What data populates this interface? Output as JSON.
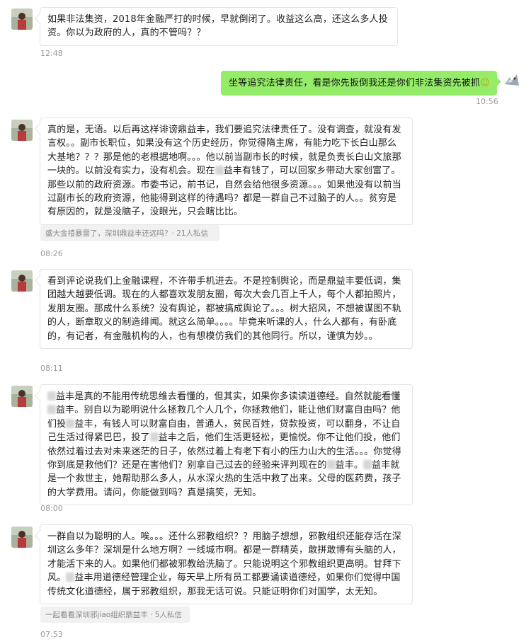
{
  "messages": [
    {
      "text": "如果非法集资，2018年金融严打的时候，早就倒闭了。收益这么高，还这么多人投资。你以为政府的人，真的不管吗？？",
      "time": "12:48"
    },
    {
      "text": "坐等追究法律责任，看是你先扳倒我还是你们非法集资先被抓",
      "emoji": "☺",
      "time": "10:56"
    },
    {
      "text_a": "真的是，无语。以后再这样诽谤鼎益丰，我们要追究法律责任了。没有调查，就没有发言权。。副市长职位，如果没有这个历史经历，你觉得隋主席，有能力吃下长白山那么大基地？？？那是他的老根据地啊。。。他以前当副市长的时候，就是负责长白山文旅那一块的。以前没有实力，没有机会。现在",
      "text_b": "益丰有钱了，可以回家乡带动大家创富了。那些以前的政府资源。市委书记，前书记，自然会给他很多资源。。。如果他没有以前当过副市长的政府资源，他能得到这样的待遇吗？都是一群自己不过脑子的人。。贫穷是有原因的，就是没脑子，没眼光，只会瞎比比。",
      "quote": "盛大金禧暴雷了，深圳鼎益丰还远吗？· 21人私信",
      "time": "08:26"
    },
    {
      "text": "看到评论说我们上金融课程，不许带手机进去。不是控制舆论，而是鼎益丰要低调，集团越大越要低调。现在的人都喜欢发朋友圈，每次大会几百上千人，每个人都拍照片，发朋友圈。那成什么系统？没有舆论，都被搞成舆论了。。。树大招风，不想被谋图不轨的人，断章取义的制造绯闻。就这么简单。。。。毕竟来听课的人，什么人都有，有卧底的，有记者，有金融机构的人，也有想模仿我们的其他同行。所以，谨慎为妙。。",
      "time": "08:11"
    },
    {
      "text_a": "益丰是真的不能用传统思维去看懂的，但其实，如果你多读读道德经。自然就能看懂",
      "text_b": "益丰。别自以为聪明说什么拯救几个人几个，你拯救他们，能让他们财富自由吗？他们投",
      "text_c": "益丰，有钱人可以财富自由，普通人，贫民百姓，贷款投资，可以翻身，不让自己生活过得紧巴巴，投了",
      "text_d": "益丰之后，他们生活更轻松，更愉悦。你不让他们投，他们依然过着过去对未来迷茫的日子，依然过着上有老下有小的压力山大的生活。。。你觉得你到底是救他们？还是在害他们？别拿自己过去的经验来评判现在的",
      "text_e": "益丰。",
      "text_f": "益丰就是一个救世主，她帮助那么多人，从水深火热的生活中救了出来。父母的医药费，孩子的大学费用。请问，你能做到吗？真是搞笑，无知。",
      "time": "08:00"
    },
    {
      "text_a": "一群自以为聪明的人。唉。。。还什么邪教组织？？用脑子想想，邪教组织还能存活在深圳这么多年？深圳是什么地方啊？一线城市啊。都是一群精英，敢拼敢博有头脑的人，才能活下来的人。如果他们都被邪教给洗脑了。只能说明这个邪教组织更高明。甘拜下风。",
      "text_b": "益丰用道德经管理企业，每天早上所有员工都要诵读道德经，如果你们觉得中国传统文化道德经，属于邪教组织，那我无话可说。只能证明你们对国学，太无知。",
      "quote": "一起看看深圳邪jiao组织鼎益丰 · 5人私信",
      "time": "07:53"
    }
  ]
}
